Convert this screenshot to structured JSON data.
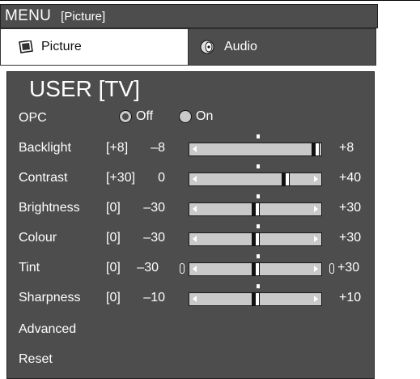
{
  "menubar": {
    "title": "MENU",
    "section": "[Picture]"
  },
  "tabs": [
    {
      "label": "Picture",
      "icon": "picture-icon",
      "selected": true
    },
    {
      "label": "Audio",
      "icon": "speaker-icon",
      "selected": false
    }
  ],
  "panel": {
    "title": "USER [TV]",
    "opc": {
      "label": "OPC",
      "options": [
        "Off",
        "On"
      ],
      "selected": "Off"
    },
    "settings": [
      {
        "label": "Backlight",
        "current": "[+8]",
        "min": "–8",
        "max": "+8",
        "value": 8,
        "range": [
          -8,
          8
        ]
      },
      {
        "label": "Contrast",
        "current": "[+30]",
        "min": "0",
        "max": "+40",
        "value": 30,
        "range": [
          0,
          40
        ]
      },
      {
        "label": "Brightness",
        "current": "[0]",
        "min": "–30",
        "max": "+30",
        "value": 0,
        "range": [
          -30,
          30
        ]
      },
      {
        "label": "Colour",
        "current": "[0]",
        "min": "–30",
        "max": "+30",
        "value": 0,
        "range": [
          -30,
          30
        ]
      },
      {
        "label": "Tint",
        "current": "[0]",
        "min": "–30",
        "max": "+30",
        "value": 0,
        "range": [
          -30,
          30
        ]
      },
      {
        "label": "Sharpness",
        "current": "[0]",
        "min": "–10",
        "max": "+10",
        "value": 0,
        "range": [
          -10,
          10
        ]
      }
    ],
    "advanced": "Advanced",
    "reset": "Reset"
  },
  "colors": {
    "panel": "#4d4d4d",
    "slider_track": "#c9c9c9",
    "text": "#ffffff"
  }
}
